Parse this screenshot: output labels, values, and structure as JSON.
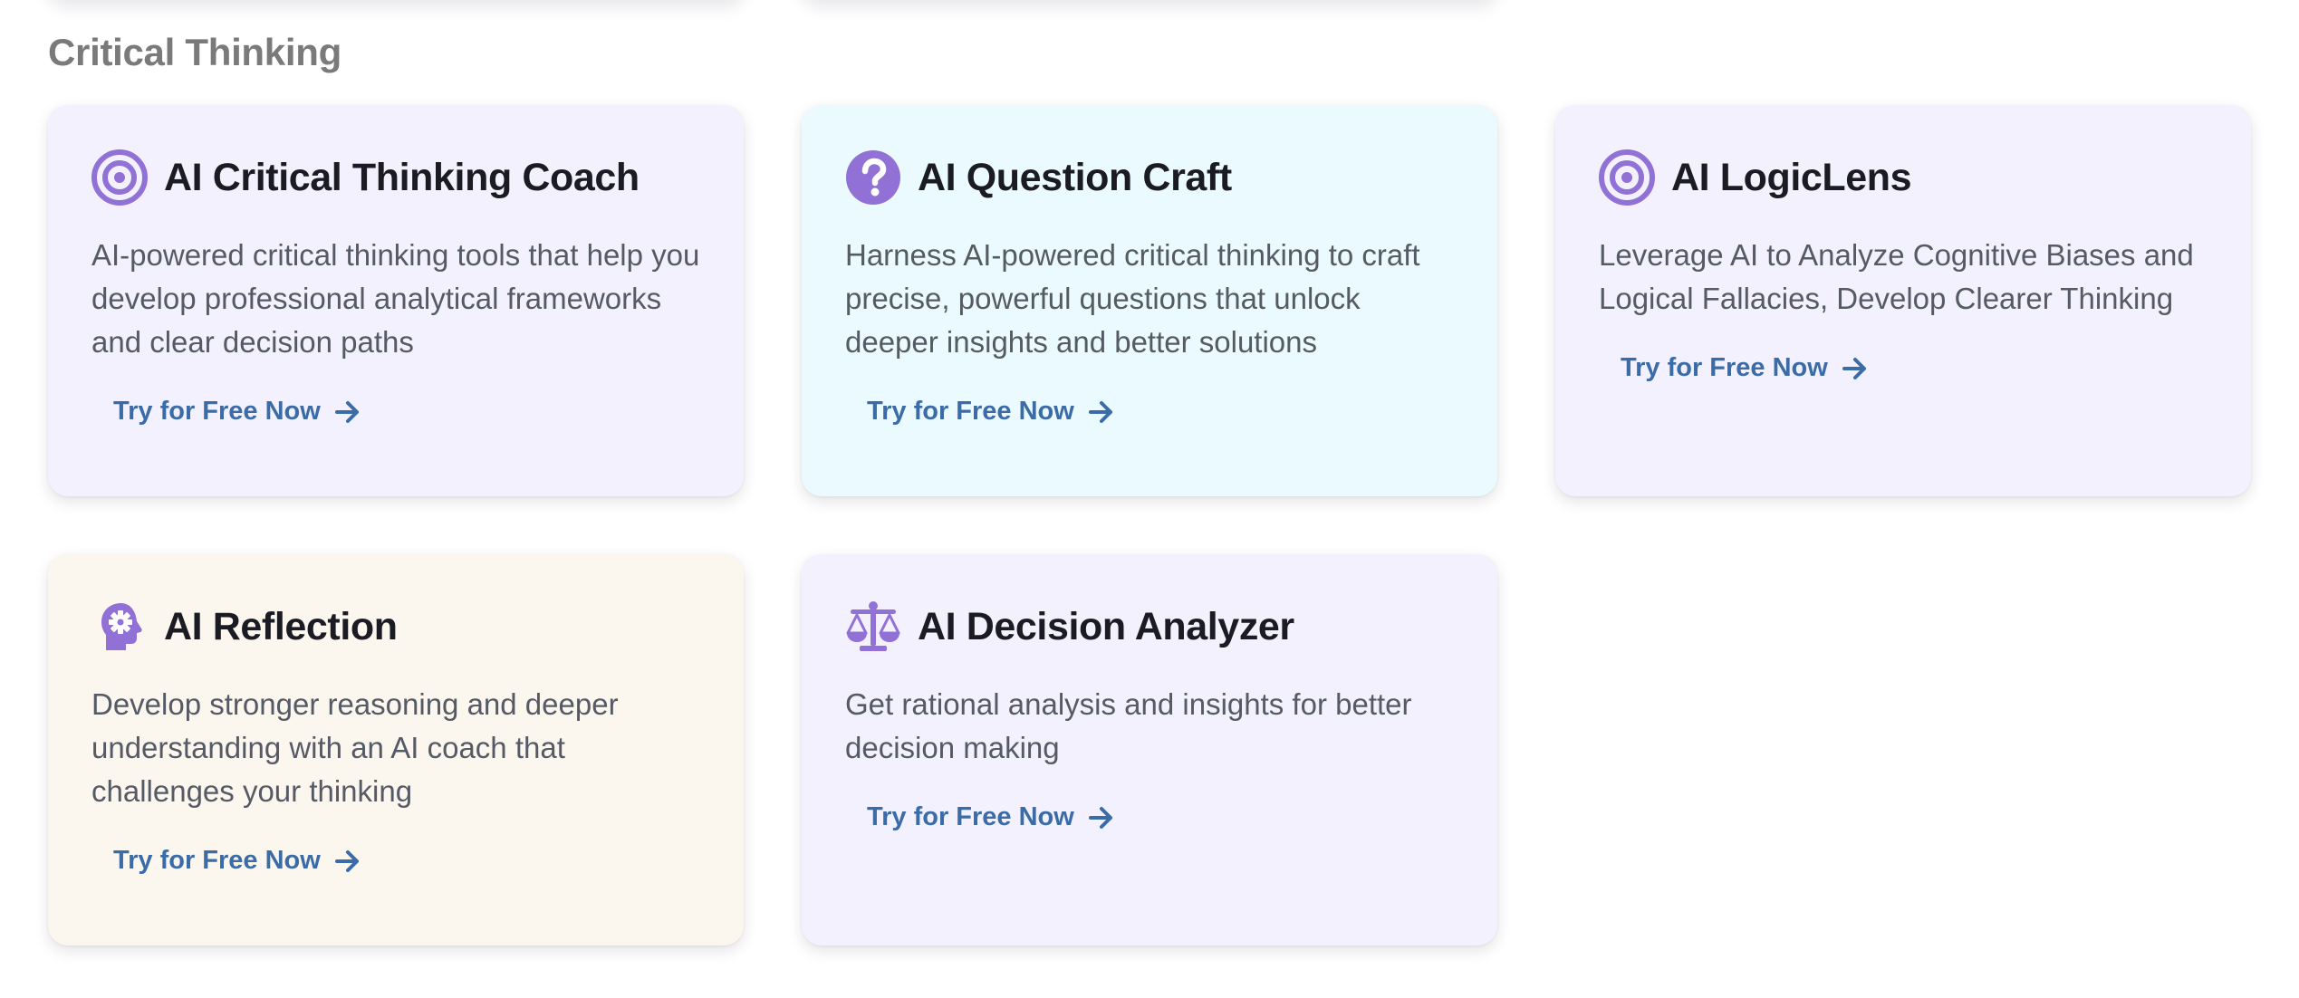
{
  "section": {
    "title": "Critical Thinking"
  },
  "cards": [
    {
      "title": "AI Critical Thinking Coach",
      "description": "AI-powered critical thinking tools that help you develop professional analytical frameworks and clear decision paths",
      "cta": "Try for Free Now",
      "icon": "target-icon",
      "background": "#f2f1fd"
    },
    {
      "title": "AI Question Craft",
      "description": "Harness AI-powered critical thinking to craft precise, powerful questions that unlock deeper insights and better solutions",
      "cta": "Try for Free Now",
      "icon": "question-circle-icon",
      "background": "#ebfafe"
    },
    {
      "title": "AI LogicLens",
      "description": "Leverage AI to Analyze Cognitive Biases and Logical Fallacies, Develop Clearer Thinking",
      "cta": "Try for Free Now",
      "icon": "target-icon",
      "background": "#f2f1fd"
    },
    {
      "title": "AI Reflection",
      "description": "Develop stronger reasoning and deeper understanding with an AI coach that challenges your thinking",
      "cta": "Try for Free Now",
      "icon": "head-gear-icon",
      "background": "#fcf7ee"
    },
    {
      "title": "AI Decision Analyzer",
      "description": "Get rational analysis and insights for better decision making",
      "cta": "Try for Free Now",
      "icon": "balance-scale-icon",
      "background": "#f2f1fd"
    }
  ],
  "colors": {
    "icon": "#9271d6",
    "cta": "#3b6ca8",
    "title": "#1b1b24",
    "description": "#555a66",
    "section_title": "#7a7a7a"
  }
}
